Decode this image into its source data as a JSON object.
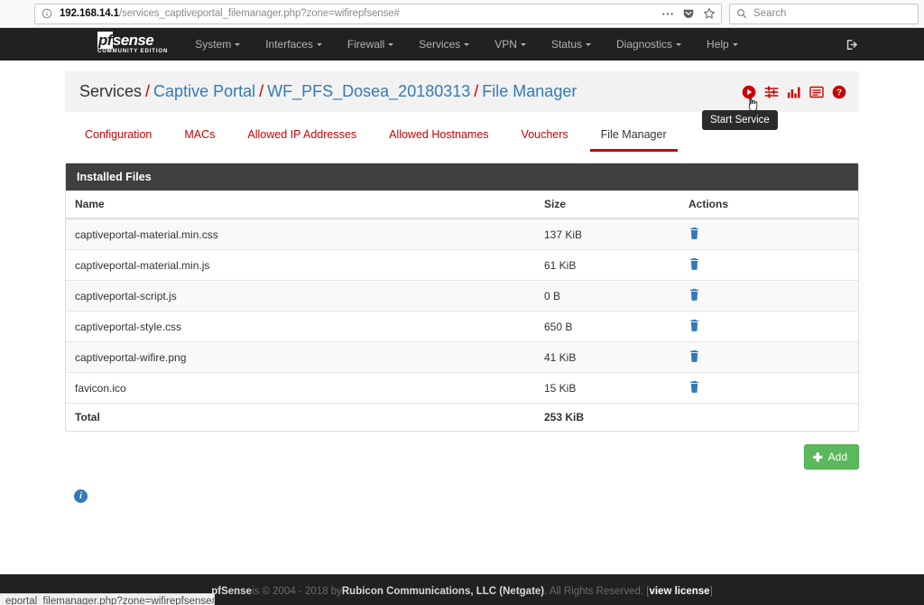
{
  "browser": {
    "identity_icon": "info-circle-icon",
    "url_host": "192.168.14.1",
    "url_path": "/services_captiveportal_filemanager.php?zone=wifirepfsense#",
    "page_actions_icon": "ellipsis-icon",
    "pocket_icon": "pocket-icon",
    "bookmark_icon": "star-icon",
    "search_icon": "search-icon",
    "search_placeholder": "Search"
  },
  "navbar": {
    "brand_prefix": "pf",
    "brand_suffix": "sense",
    "brand_sub": "COMMUNITY EDITION",
    "items": [
      {
        "label": "System"
      },
      {
        "label": "Interfaces"
      },
      {
        "label": "Firewall"
      },
      {
        "label": "Services"
      },
      {
        "label": "VPN"
      },
      {
        "label": "Status"
      },
      {
        "label": "Diagnostics"
      },
      {
        "label": "Help"
      }
    ],
    "logout_icon": "logout-icon"
  },
  "breadcrumb": {
    "root": "Services",
    "sep": "/",
    "items": [
      {
        "label": "Captive Portal"
      },
      {
        "label": "WF_PFS_Dosea_20180313"
      },
      {
        "label": "File Manager"
      }
    ]
  },
  "header_icons": [
    {
      "name": "start-service-icon",
      "title": "Start Service"
    },
    {
      "name": "sliders-icon",
      "title": ""
    },
    {
      "name": "bar-chart-icon",
      "title": ""
    },
    {
      "name": "list-icon",
      "title": ""
    },
    {
      "name": "help-icon",
      "title": ""
    }
  ],
  "tooltip": {
    "text": "Start Service"
  },
  "tabs": [
    {
      "label": "Configuration",
      "active": false
    },
    {
      "label": "MACs",
      "active": false
    },
    {
      "label": "Allowed IP Addresses",
      "active": false
    },
    {
      "label": "Allowed Hostnames",
      "active": false
    },
    {
      "label": "Vouchers",
      "active": false
    },
    {
      "label": "File Manager",
      "active": true
    }
  ],
  "panel": {
    "title": "Installed Files",
    "columns": [
      "Name",
      "Size",
      "Actions"
    ],
    "rows": [
      {
        "name": "captiveportal-material.min.css",
        "size": "137 KiB",
        "action_icon": "trash-icon"
      },
      {
        "name": "captiveportal-material.min.js",
        "size": "61 KiB",
        "action_icon": "trash-icon"
      },
      {
        "name": "captiveportal-script.js",
        "size": "0 B",
        "action_icon": "trash-icon"
      },
      {
        "name": "captiveportal-style.css",
        "size": "650 B",
        "action_icon": "trash-icon"
      },
      {
        "name": "captiveportal-wifire.png",
        "size": "41 KiB",
        "action_icon": "trash-icon"
      },
      {
        "name": "favicon.ico",
        "size": "15 KiB",
        "action_icon": "trash-icon"
      }
    ],
    "total_label": "Total",
    "total_size": "253 KiB"
  },
  "add_button": {
    "label": "Add",
    "icon": "plus-icon"
  },
  "info_icon": {
    "name": "info-icon",
    "glyph": "i"
  },
  "footer": {
    "brand": "pfSense",
    "text_1": " is © 2004 - 2018 by ",
    "company": "Rubicon Communications, LLC (Netgate)",
    "text_2": ". All Rights Reserved. [",
    "license_link": "view license",
    "text_3": "]"
  },
  "statusbar": {
    "text": "eportal_filemanager.php?zone=wifirepfsense#"
  },
  "colors": {
    "navbar_bg": "#212121",
    "accent_red": "#cc0000",
    "link_blue": "#337ab7",
    "panel_heading_bg": "#3f3f3f",
    "add_green": "#5cb85c"
  }
}
